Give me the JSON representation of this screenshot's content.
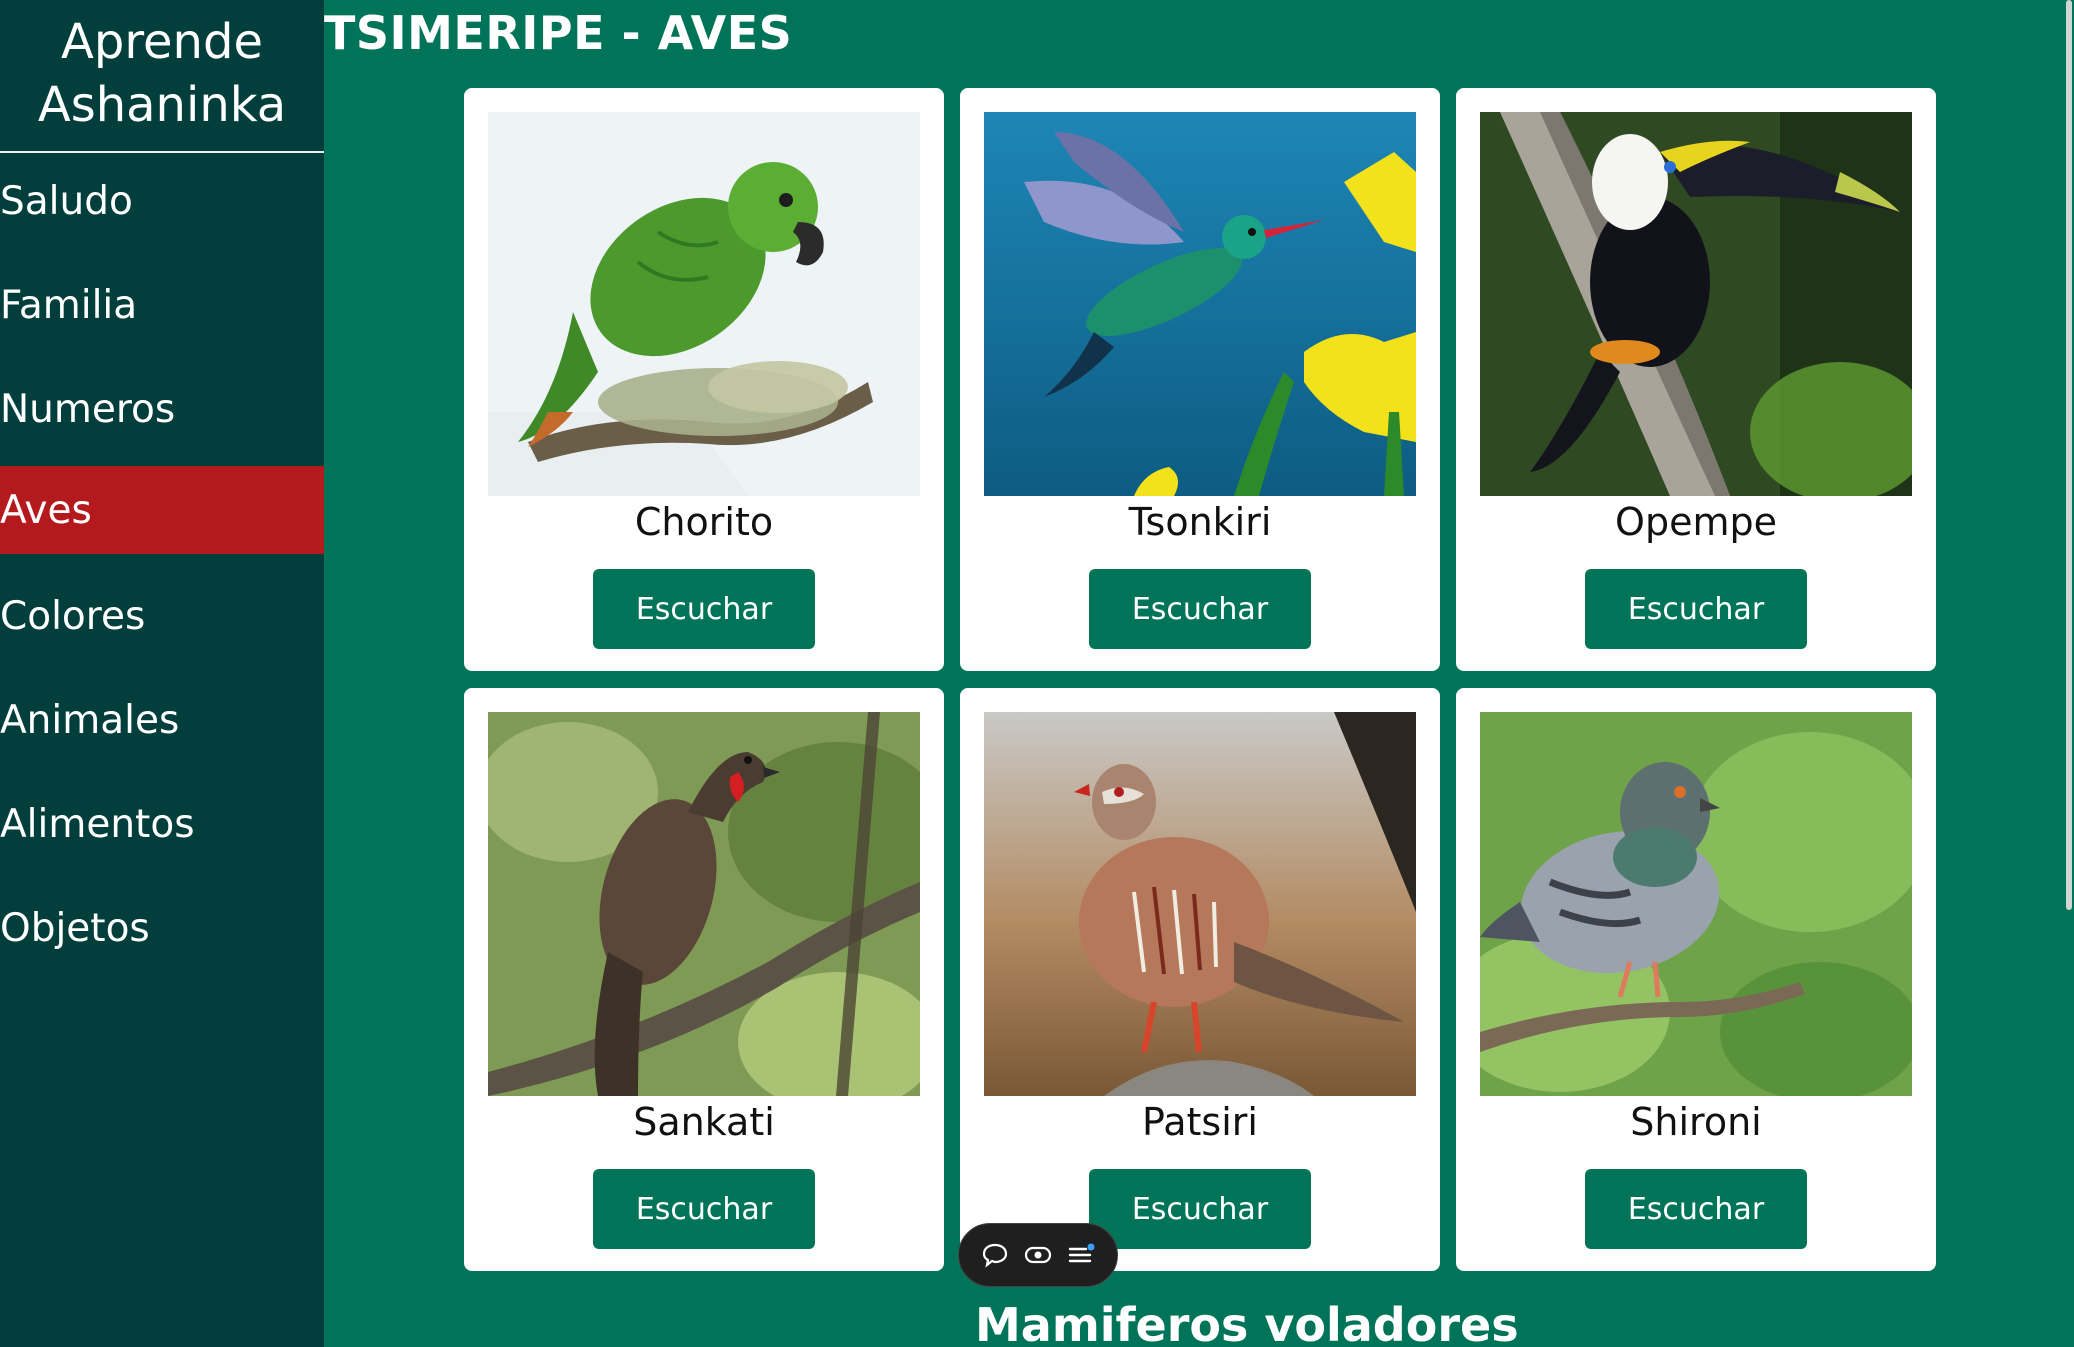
{
  "sidebar": {
    "brand_line1": "Aprende",
    "brand_line2": "Ashaninka",
    "items": [
      {
        "label": "Saludo"
      },
      {
        "label": "Familia"
      },
      {
        "label": "Numeros"
      },
      {
        "label": "Aves",
        "active": true
      },
      {
        "label": "Colores"
      },
      {
        "label": "Animales"
      },
      {
        "label": "Alimentos"
      },
      {
        "label": "Objetos"
      }
    ]
  },
  "main": {
    "title": "TSIMERIPE - AVES",
    "cards": [
      {
        "name": "Chorito",
        "button": "Escuchar",
        "image": "green-parrot"
      },
      {
        "name": "Tsonkiri",
        "button": "Escuchar",
        "image": "hummingbird"
      },
      {
        "name": "Opempe",
        "button": "Escuchar",
        "image": "toucan"
      },
      {
        "name": "Sankati",
        "button": "Escuchar",
        "image": "guan"
      },
      {
        "name": "Patsiri",
        "button": "Escuchar",
        "image": "partridge"
      },
      {
        "name": "Shironi",
        "button": "Escuchar",
        "image": "pigeon"
      }
    ],
    "next_section": "Mamiferos voladores"
  },
  "toolbar": {
    "icons": [
      "chat-bubble-icon",
      "eye-icon",
      "menu-list-icon"
    ]
  },
  "colors": {
    "main_bg": "#007459",
    "sidebar_bg": "#023f3c",
    "active_item": "#b3191d",
    "button": "#007459"
  }
}
